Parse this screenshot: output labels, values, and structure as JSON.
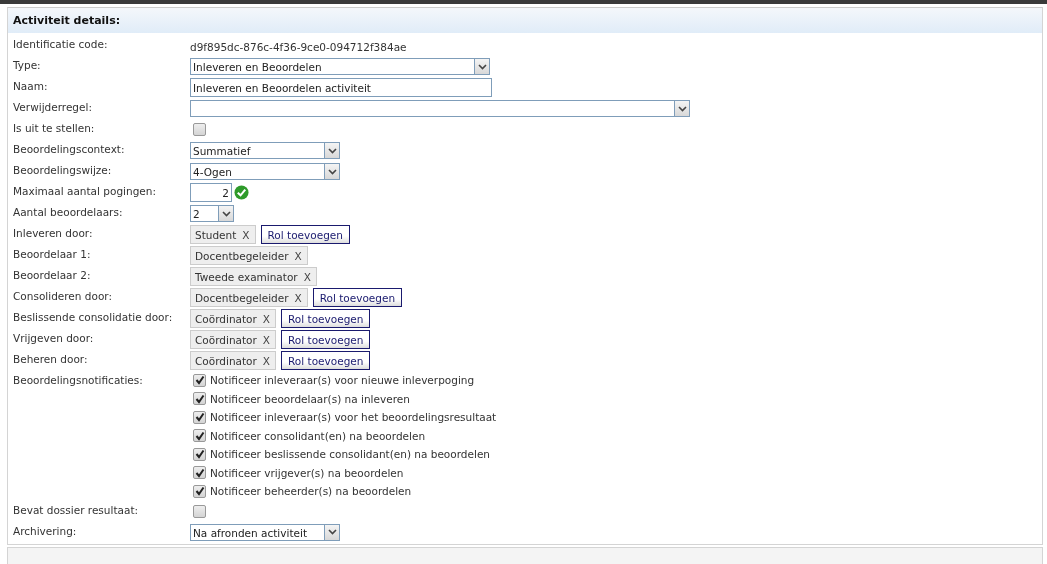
{
  "panel": {
    "title": "Activiteit details:"
  },
  "fields": [
    {
      "kind": "text",
      "label": "Identificatie code:",
      "value": "d9f895dc-876c-4f36-9ce0-094712f384ae"
    },
    {
      "kind": "select",
      "label": "Type:",
      "value": "Inleveren en Beoordelen"
    },
    {
      "kind": "input",
      "label": "Naam:",
      "value": "Inleveren en Beoordelen activiteit"
    },
    {
      "kind": "select",
      "label": "Verwijderregel:"
    },
    {
      "kind": "checkbox",
      "label": "Is uit te stellen:",
      "checked": false
    },
    {
      "kind": "select",
      "label": "Beoordelingscontext:",
      "value": "Summatief"
    },
    {
      "kind": "select",
      "label": "Beoordelingswijze:",
      "value": "4-Ogen"
    },
    {
      "kind": "number",
      "label": "Maximaal aantal pogingen:",
      "value": "2",
      "valid": true
    },
    {
      "kind": "select",
      "label": "Aantal beoordelaars:",
      "value": "2"
    },
    {
      "kind": "roles",
      "label": "Inleveren door:",
      "roles": [
        {
          "name": "Student",
          "remove": "X"
        }
      ],
      "add": "Rol toevoegen"
    },
    {
      "kind": "roles",
      "label": "Beoordelaar 1:",
      "roles": [
        {
          "name": "Docentbegeleider",
          "remove": "X"
        }
      ]
    },
    {
      "kind": "roles",
      "label": "Beoordelaar 2:",
      "roles": [
        {
          "name": "Tweede examinator",
          "remove": "X"
        }
      ]
    },
    {
      "kind": "roles",
      "label": "Consolideren door:",
      "roles": [
        {
          "name": "Docentbegeleider",
          "remove": "X"
        }
      ],
      "add": "Rol toevoegen"
    },
    {
      "kind": "roles",
      "label": "Beslissende consolidatie door:",
      "roles": [
        {
          "name": "Coördinator",
          "remove": "X"
        }
      ],
      "add": "Rol toevoegen"
    },
    {
      "kind": "roles",
      "label": "Vrijgeven door:",
      "roles": [
        {
          "name": "Coördinator",
          "remove": "X"
        }
      ],
      "add": "Rol toevoegen"
    },
    {
      "kind": "roles",
      "label": "Beheren door:",
      "roles": [
        {
          "name": "Coördinator",
          "remove": "X"
        }
      ],
      "add": "Rol toevoegen"
    },
    {
      "kind": "checklist",
      "label": "Beoordelingsnotificaties:",
      "options": [
        {
          "label": "Notificeer inleveraar(s) voor nieuwe inleverpoging",
          "checked": true
        },
        {
          "label": "Notificeer beoordelaar(s) na inleveren",
          "checked": true
        },
        {
          "label": "Notificeer inleveraar(s) voor het beoordelingsresultaat",
          "checked": true
        },
        {
          "label": "Notificeer consolidant(en) na beoordelen",
          "checked": true
        },
        {
          "label": "Notificeer beslissende consolidant(en) na beoordelen",
          "checked": true
        },
        {
          "label": "Notificeer vrijgever(s) na beoordelen",
          "checked": true
        },
        {
          "label": "Notificeer beheerder(s) na beoordelen",
          "checked": true
        }
      ]
    },
    {
      "kind": "checkbox",
      "label": "Bevat dossier resultaat:",
      "checked": false
    },
    {
      "kind": "select",
      "label": "Archivering:",
      "value": "Na afronden activiteit"
    }
  ]
}
